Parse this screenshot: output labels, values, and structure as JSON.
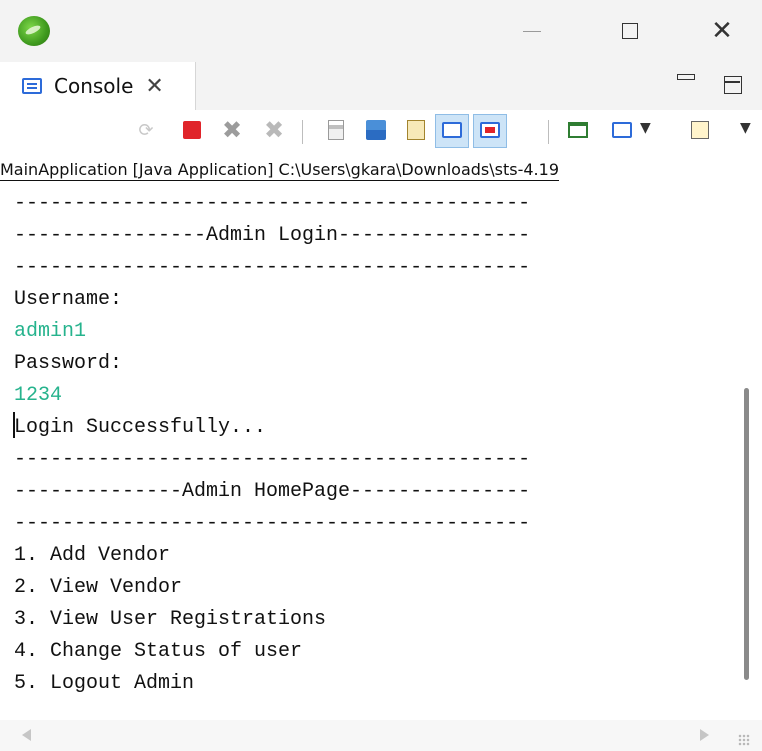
{
  "window": {
    "app_icon": "spring-leaf-icon",
    "controls": [
      "minimize-icon",
      "maximize-icon",
      "close-icon"
    ],
    "close_glyph": "✕"
  },
  "tab": {
    "label": "Console",
    "icon": "console-icon",
    "close_glyph": "✕"
  },
  "toolbar": {
    "icons": [
      "sync-icon",
      "terminate-icon",
      "remove-launch-icon",
      "remove-all-terminated-icon",
      "clear-console-icon",
      "scroll-lock-icon",
      "word-wrap-icon",
      "show-on-stdout-icon",
      "show-on-stderr-icon",
      "pin-console-icon",
      "display-console-icon",
      "open-console-icon"
    ],
    "remove_glyph": "✖",
    "sync_glyph": "⟳",
    "dropdown_glyph": "▼"
  },
  "launch": {
    "text": "MainApplication [Java Application] C:\\Users\\gkara\\Downloads\\sts-4.19"
  },
  "console": {
    "lines": [
      {
        "text": "-------------------------------------------",
        "kind": "out"
      },
      {
        "text": "----------------Admin Login----------------",
        "kind": "out"
      },
      {
        "text": "-------------------------------------------",
        "kind": "out"
      },
      {
        "text": "Username:",
        "kind": "out"
      },
      {
        "text": "admin1",
        "kind": "in"
      },
      {
        "text": "Password:",
        "kind": "out"
      },
      {
        "text": "1234",
        "kind": "in"
      },
      {
        "text": "Login Successfully...",
        "kind": "out"
      },
      {
        "text": "-------------------------------------------",
        "kind": "out"
      },
      {
        "text": "--------------Admin HomePage---------------",
        "kind": "out"
      },
      {
        "text": "-------------------------------------------",
        "kind": "out"
      },
      {
        "text": "1. Add Vendor",
        "kind": "out"
      },
      {
        "text": "2. View Vendor",
        "kind": "out"
      },
      {
        "text": "3. View User Registrations",
        "kind": "out"
      },
      {
        "text": "4. Change Status of user",
        "kind": "out"
      },
      {
        "text": "5. Logout Admin",
        "kind": "out"
      }
    ],
    "input_color": "#26b38d",
    "text_color": "#111111"
  },
  "colors": {
    "accent_blue": "#2d6bd9",
    "stop_red": "#e0242a",
    "pressed_bg": "#cde4f7"
  }
}
